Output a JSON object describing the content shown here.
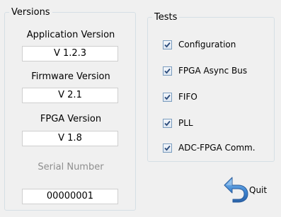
{
  "versions": {
    "title": "Versions",
    "application": {
      "label": "Application Version",
      "value": "V 1.2.3"
    },
    "firmware": {
      "label": "Firmware Version",
      "value": "V 2.1"
    },
    "fpga": {
      "label": "FPGA Version",
      "value": "V 1.8"
    },
    "serial": {
      "label": "Serial Number",
      "value": "00000001"
    }
  },
  "tests": {
    "title": "Tests",
    "items": [
      {
        "label": "Configuration",
        "checked": true
      },
      {
        "label": "FPGA Async Bus",
        "checked": true
      },
      {
        "label": "FIFO",
        "checked": true
      },
      {
        "label": "PLL",
        "checked": true
      },
      {
        "label": "ADC-FPGA Comm.",
        "checked": true
      }
    ]
  },
  "quit": {
    "label": "Quit",
    "icon": "back-arrow-icon"
  },
  "colors": {
    "background": "#f0f0f0",
    "group_border": "#d5dfe5",
    "checkbox_border": "#7a9cbe",
    "check_mark": "#2a4a7a",
    "arrow_blue": "#4a8fd6",
    "disabled_text": "#8e8e8e"
  }
}
